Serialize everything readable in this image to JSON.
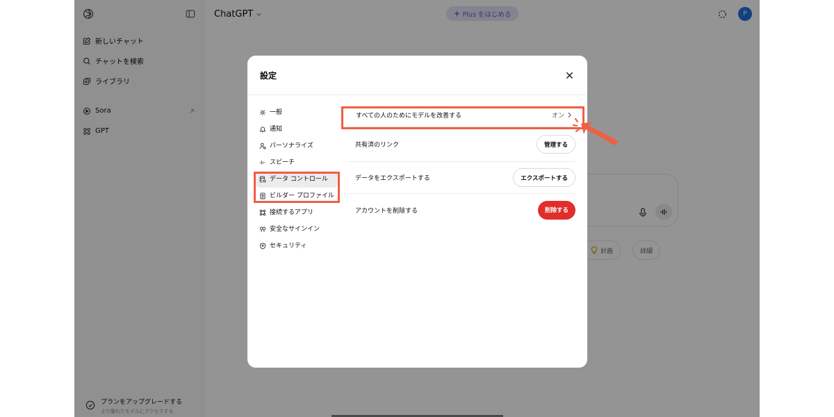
{
  "sidebar": {
    "items": [
      {
        "label": "新しいチャット",
        "icon": "compose-icon"
      },
      {
        "label": "チャットを検索",
        "icon": "search-icon"
      },
      {
        "label": "ライブラリ",
        "icon": "library-icon"
      }
    ],
    "apps": [
      {
        "label": "Sora",
        "icon": "play-circle-icon"
      },
      {
        "label": "GPT",
        "icon": "grid-icon"
      }
    ],
    "upgrade": {
      "title": "プランをアップグレードする",
      "subtitle": "より優れたモデルにアクセスする"
    }
  },
  "topbar": {
    "model": "ChatGPT",
    "plus_label": "Plus をはじめる",
    "avatar_initial": "P"
  },
  "background_chips": [
    {
      "label": "計画"
    },
    {
      "label": "詳細"
    }
  ],
  "modal": {
    "title": "設定",
    "nav": [
      {
        "label": "一般",
        "icon": "gear-icon"
      },
      {
        "label": "通知",
        "icon": "bell-icon"
      },
      {
        "label": "パーソナライズ",
        "icon": "person-icon"
      },
      {
        "label": "スピーチ",
        "icon": "waveform-icon"
      },
      {
        "label": "データ コントロール",
        "icon": "database-icon",
        "active": true
      },
      {
        "label": "ビルダー プロファイル",
        "icon": "id-card-icon"
      },
      {
        "label": "接続するアプリ",
        "icon": "apps-icon"
      },
      {
        "label": "安全なサインイン",
        "icon": "key-icon"
      },
      {
        "label": "セキュリティ",
        "icon": "shield-icon"
      }
    ],
    "rows": [
      {
        "label": "すべての人のためにモデルを改善する",
        "value": "オン"
      },
      {
        "label": "共有済のリンク",
        "button": "管理する"
      },
      {
        "label": "データをエクスポートする",
        "button": "エクスポートする"
      },
      {
        "label": "アカウントを削除する",
        "button": "削除する"
      }
    ]
  },
  "colors": {
    "highlight": "#ef5f43",
    "danger": "#e02e2a",
    "accent": "#5d5bd4",
    "avatar": "#2070dc"
  }
}
